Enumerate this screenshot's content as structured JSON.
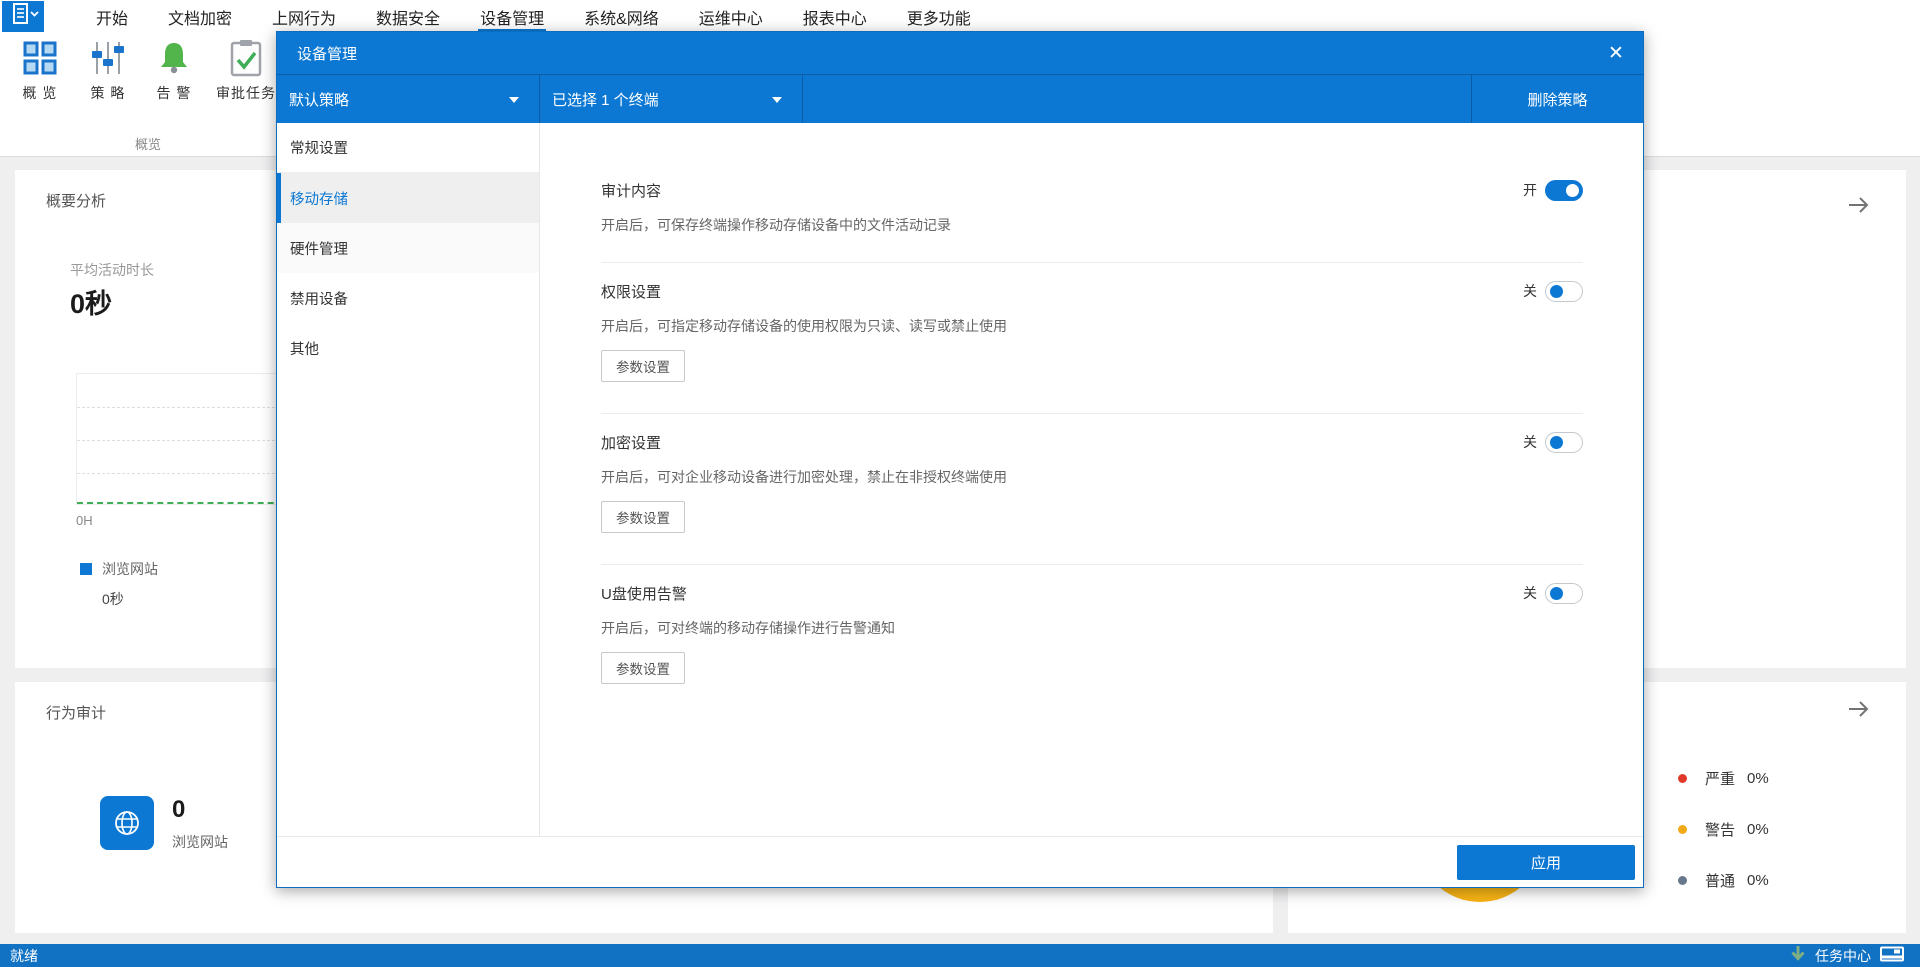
{
  "menubar": {
    "items": [
      {
        "id": "start",
        "label": "开始",
        "active": false
      },
      {
        "id": "doc-encrypt",
        "label": "文档加密",
        "active": false
      },
      {
        "id": "web-behavior",
        "label": "上网行为",
        "active": false
      },
      {
        "id": "data-security",
        "label": "数据安全",
        "active": false
      },
      {
        "id": "device-management",
        "label": "设备管理",
        "active": true
      },
      {
        "id": "system-network",
        "label": "系统&网络",
        "active": false
      },
      {
        "id": "ops-center",
        "label": "运维中心",
        "active": false
      },
      {
        "id": "report-center",
        "label": "报表中心",
        "active": false
      },
      {
        "id": "more-features",
        "label": "更多功能",
        "active": false
      }
    ]
  },
  "ribbon": {
    "tools": [
      {
        "id": "overview",
        "label": "概 览",
        "icon": "grid-icon"
      },
      {
        "id": "policy",
        "label": "策 略",
        "icon": "sliders-icon"
      },
      {
        "id": "alert",
        "label": "告 警",
        "icon": "bell-icon"
      },
      {
        "id": "approval",
        "label": "审批任务",
        "icon": "clipboard-check-icon"
      }
    ],
    "group_label": "概览"
  },
  "page": {
    "summary_card": {
      "title": "概要分析",
      "metric_label": "平均活动时长",
      "metric_value": "0秒",
      "chart_x_tick": "0H",
      "legend_label": "浏览网站",
      "legend_value": "0秒",
      "legend_color": "#0c78d3"
    },
    "audit_card": {
      "title": "行为审计",
      "stat_value": "0",
      "stat_label": "浏览网站"
    },
    "alarm_card": {
      "levels": [
        {
          "id": "critical",
          "label": "严重",
          "value": "0%",
          "color": "#e0392a"
        },
        {
          "id": "warning",
          "label": "警告",
          "value": "0%",
          "color": "#f2a918"
        },
        {
          "id": "normal",
          "label": "普通",
          "value": "0%",
          "color": "#68788c"
        }
      ],
      "gauge_color": "#f7b500"
    }
  },
  "modal": {
    "title": "设备管理",
    "close_glyph": "✕",
    "policy_dropdown_value": "默认策略",
    "terminal_dropdown_value": "已选择 1 个终端",
    "delete_button_label": "删除策略",
    "nav": [
      {
        "id": "general-settings",
        "label": "常规设置",
        "active": false
      },
      {
        "id": "removable-storage",
        "label": "移动存储",
        "active": true
      },
      {
        "id": "hardware-management",
        "label": "硬件管理",
        "active": false
      },
      {
        "id": "disabled-devices",
        "label": "禁用设备",
        "active": false
      },
      {
        "id": "other",
        "label": "其他",
        "active": false
      }
    ],
    "sections": [
      {
        "id": "audit-content",
        "title": "审计内容",
        "toggle_on": true,
        "toggle_label": "开",
        "desc": "开启后，可保存终端操作移动存储设备中的文件活动记录",
        "param_button": null
      },
      {
        "id": "permission-settings",
        "title": "权限设置",
        "toggle_on": false,
        "toggle_label": "关",
        "desc": "开启后，可指定移动存储设备的使用权限为只读、读写或禁止使用",
        "param_button": "参数设置"
      },
      {
        "id": "encryption-settings",
        "title": "加密设置",
        "toggle_on": false,
        "toggle_label": "关",
        "desc": "开启后，可对企业移动设备进行加密处理，禁止在非授权终端使用",
        "param_button": "参数设置"
      },
      {
        "id": "usb-usage-alert",
        "title": "U盘使用告警",
        "toggle_on": false,
        "toggle_label": "关",
        "desc": "开启后，可对终端的移动存储操作进行告警通知",
        "param_button": "参数设置"
      }
    ],
    "apply_button_label": "应用"
  },
  "statusbar": {
    "left_text": "就绪",
    "task_center_label": "任务中心"
  }
}
